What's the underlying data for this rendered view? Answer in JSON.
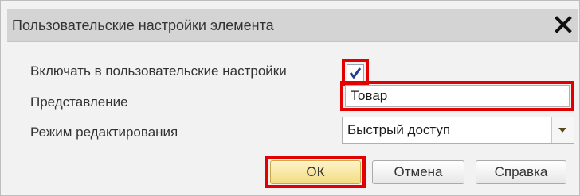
{
  "dialog": {
    "title": "Пользовательские настройки элемента",
    "close_icon": "close-icon"
  },
  "form": {
    "include_label": "Включать в пользовательские настройки",
    "include_checked": true,
    "presentation_label": "Представление",
    "presentation_value": "Товар",
    "edit_mode_label": "Режим редактирования",
    "edit_mode_value": "Быстрый доступ",
    "dropdown_icon": "chevron-down-icon"
  },
  "buttons": {
    "ok": "ОК",
    "cancel": "Отмена",
    "help": "Справка"
  },
  "colors": {
    "highlight": "#e30000",
    "checkmark": "#1c3f94",
    "default_button": "#f3dc82"
  }
}
